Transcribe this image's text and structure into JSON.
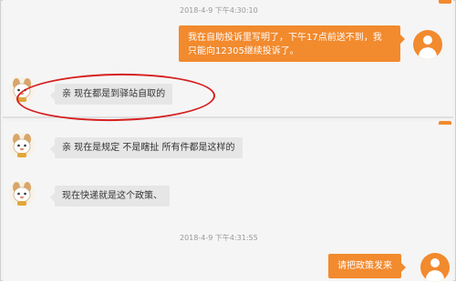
{
  "chat": {
    "timestamp_1": "2018-4-9 下午4:30:10",
    "timestamp_2": "2018-4-9 下午4:31:55",
    "messages": [
      {
        "from": "user",
        "text_line1": "我在自助投诉里写明了，下午17点前送不到，我",
        "text_line2": "只能向12305继续投诉了。"
      },
      {
        "from": "agent",
        "text": "亲 现在都是到驿站自取的"
      },
      {
        "from": "agent",
        "text": "亲 现在是规定 不是瞎扯 所有件都是这样的"
      },
      {
        "from": "agent",
        "text": "现在快递就是这个政策、"
      },
      {
        "from": "user",
        "text": "请把政策发来"
      }
    ]
  },
  "colors": {
    "accent_orange": "#f28a2e",
    "incoming_bubble": "#e6e6e6",
    "highlight_red": "#d62020"
  },
  "icons": {
    "user_avatar": "user-silhouette-icon",
    "agent_avatar": "cartoon-mascot-icon"
  }
}
